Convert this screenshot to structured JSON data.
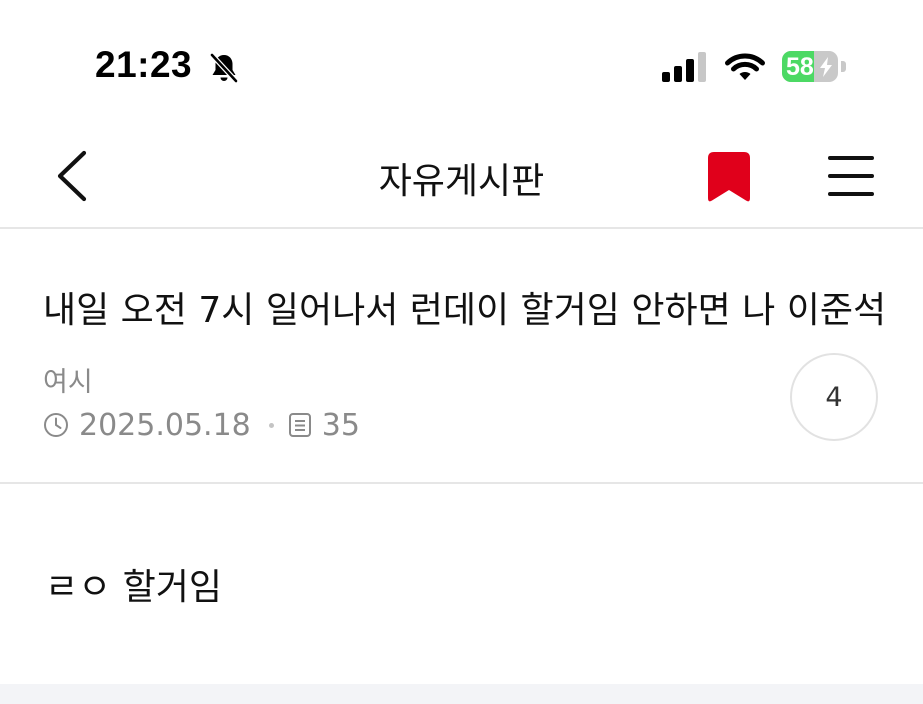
{
  "status_bar": {
    "time": "21:23",
    "battery_percent": "58",
    "battery_level": 0.58,
    "icons": [
      "bell-slash-icon",
      "cellular-signal-icon",
      "wifi-icon",
      "battery-charging-icon"
    ]
  },
  "nav": {
    "title": "자유게시판",
    "icons": [
      "chevron-left-icon",
      "bookmark-icon",
      "hamburger-menu-icon"
    ],
    "bookmark_color": "#e0001b"
  },
  "post": {
    "title": "내일 오전 7시 일어나서 런데이 할거임 안하면 나 이준석",
    "author": "여시",
    "date": "2025.05.18",
    "views": "35",
    "comment_count": "4",
    "body": "ㄹㅇ 할거임"
  },
  "colors": {
    "meta_text": "#8a8a8a",
    "divider": "#e6e6e6",
    "battery_green": "#4cd964"
  }
}
